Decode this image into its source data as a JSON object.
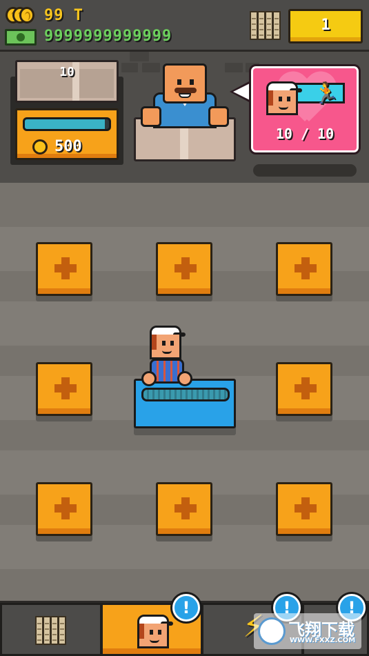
{
  "top_bar": {
    "coins": "99 T",
    "cash": "9999999999999",
    "level": "1"
  },
  "shop": {
    "crate_count": "10",
    "progress_fraction": 0.95,
    "price": "500"
  },
  "hire_bubble": {
    "workers": "10 / 10",
    "runner_icon": "running-man-icon"
  },
  "floor": {
    "empty_slots": 8,
    "slot_icon": "plus-icon"
  },
  "bottom_nav": {
    "tabs": [
      "boxes-tab",
      "workers-tab",
      "boost-tab",
      "other-tab"
    ],
    "active": "workers-tab",
    "alert_glyph": "!"
  },
  "watermark": {
    "text": "飞翔下载",
    "url": "WWW.FXXZ.COM"
  },
  "colors": {
    "orange": "#f7a21a",
    "yellow": "#f5cb12",
    "blue": "#29a2e8",
    "pink": "#f7578c",
    "cash_green": "#6cd05d"
  }
}
